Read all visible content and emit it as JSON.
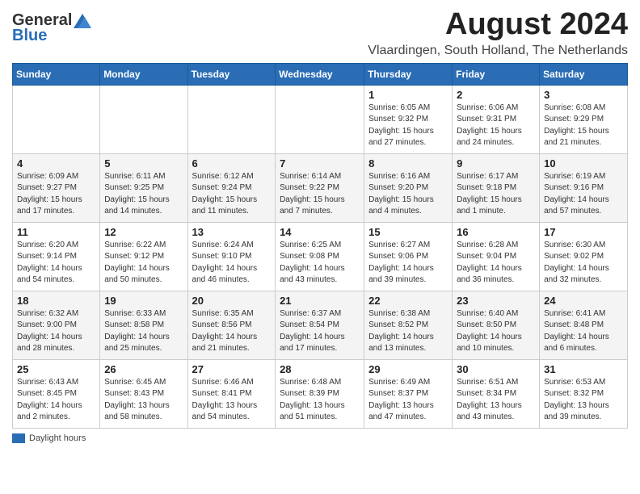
{
  "header": {
    "logo_general": "General",
    "logo_blue": "Blue",
    "month_title": "August 2024",
    "subtitle": "Vlaardingen, South Holland, The Netherlands"
  },
  "weekdays": [
    "Sunday",
    "Monday",
    "Tuesday",
    "Wednesday",
    "Thursday",
    "Friday",
    "Saturday"
  ],
  "weeks": [
    [
      {
        "day": "",
        "info": ""
      },
      {
        "day": "",
        "info": ""
      },
      {
        "day": "",
        "info": ""
      },
      {
        "day": "",
        "info": ""
      },
      {
        "day": "1",
        "info": "Sunrise: 6:05 AM\nSunset: 9:32 PM\nDaylight: 15 hours and 27 minutes."
      },
      {
        "day": "2",
        "info": "Sunrise: 6:06 AM\nSunset: 9:31 PM\nDaylight: 15 hours and 24 minutes."
      },
      {
        "day": "3",
        "info": "Sunrise: 6:08 AM\nSunset: 9:29 PM\nDaylight: 15 hours and 21 minutes."
      }
    ],
    [
      {
        "day": "4",
        "info": "Sunrise: 6:09 AM\nSunset: 9:27 PM\nDaylight: 15 hours and 17 minutes."
      },
      {
        "day": "5",
        "info": "Sunrise: 6:11 AM\nSunset: 9:25 PM\nDaylight: 15 hours and 14 minutes."
      },
      {
        "day": "6",
        "info": "Sunrise: 6:12 AM\nSunset: 9:24 PM\nDaylight: 15 hours and 11 minutes."
      },
      {
        "day": "7",
        "info": "Sunrise: 6:14 AM\nSunset: 9:22 PM\nDaylight: 15 hours and 7 minutes."
      },
      {
        "day": "8",
        "info": "Sunrise: 6:16 AM\nSunset: 9:20 PM\nDaylight: 15 hours and 4 minutes."
      },
      {
        "day": "9",
        "info": "Sunrise: 6:17 AM\nSunset: 9:18 PM\nDaylight: 15 hours and 1 minute."
      },
      {
        "day": "10",
        "info": "Sunrise: 6:19 AM\nSunset: 9:16 PM\nDaylight: 14 hours and 57 minutes."
      }
    ],
    [
      {
        "day": "11",
        "info": "Sunrise: 6:20 AM\nSunset: 9:14 PM\nDaylight: 14 hours and 54 minutes."
      },
      {
        "day": "12",
        "info": "Sunrise: 6:22 AM\nSunset: 9:12 PM\nDaylight: 14 hours and 50 minutes."
      },
      {
        "day": "13",
        "info": "Sunrise: 6:24 AM\nSunset: 9:10 PM\nDaylight: 14 hours and 46 minutes."
      },
      {
        "day": "14",
        "info": "Sunrise: 6:25 AM\nSunset: 9:08 PM\nDaylight: 14 hours and 43 minutes."
      },
      {
        "day": "15",
        "info": "Sunrise: 6:27 AM\nSunset: 9:06 PM\nDaylight: 14 hours and 39 minutes."
      },
      {
        "day": "16",
        "info": "Sunrise: 6:28 AM\nSunset: 9:04 PM\nDaylight: 14 hours and 36 minutes."
      },
      {
        "day": "17",
        "info": "Sunrise: 6:30 AM\nSunset: 9:02 PM\nDaylight: 14 hours and 32 minutes."
      }
    ],
    [
      {
        "day": "18",
        "info": "Sunrise: 6:32 AM\nSunset: 9:00 PM\nDaylight: 14 hours and 28 minutes."
      },
      {
        "day": "19",
        "info": "Sunrise: 6:33 AM\nSunset: 8:58 PM\nDaylight: 14 hours and 25 minutes."
      },
      {
        "day": "20",
        "info": "Sunrise: 6:35 AM\nSunset: 8:56 PM\nDaylight: 14 hours and 21 minutes."
      },
      {
        "day": "21",
        "info": "Sunrise: 6:37 AM\nSunset: 8:54 PM\nDaylight: 14 hours and 17 minutes."
      },
      {
        "day": "22",
        "info": "Sunrise: 6:38 AM\nSunset: 8:52 PM\nDaylight: 14 hours and 13 minutes."
      },
      {
        "day": "23",
        "info": "Sunrise: 6:40 AM\nSunset: 8:50 PM\nDaylight: 14 hours and 10 minutes."
      },
      {
        "day": "24",
        "info": "Sunrise: 6:41 AM\nSunset: 8:48 PM\nDaylight: 14 hours and 6 minutes."
      }
    ],
    [
      {
        "day": "25",
        "info": "Sunrise: 6:43 AM\nSunset: 8:45 PM\nDaylight: 14 hours and 2 minutes."
      },
      {
        "day": "26",
        "info": "Sunrise: 6:45 AM\nSunset: 8:43 PM\nDaylight: 13 hours and 58 minutes."
      },
      {
        "day": "27",
        "info": "Sunrise: 6:46 AM\nSunset: 8:41 PM\nDaylight: 13 hours and 54 minutes."
      },
      {
        "day": "28",
        "info": "Sunrise: 6:48 AM\nSunset: 8:39 PM\nDaylight: 13 hours and 51 minutes."
      },
      {
        "day": "29",
        "info": "Sunrise: 6:49 AM\nSunset: 8:37 PM\nDaylight: 13 hours and 47 minutes."
      },
      {
        "day": "30",
        "info": "Sunrise: 6:51 AM\nSunset: 8:34 PM\nDaylight: 13 hours and 43 minutes."
      },
      {
        "day": "31",
        "info": "Sunrise: 6:53 AM\nSunset: 8:32 PM\nDaylight: 13 hours and 39 minutes."
      }
    ]
  ],
  "legend": {
    "box_color": "#2a6db5",
    "label": "Daylight hours"
  }
}
